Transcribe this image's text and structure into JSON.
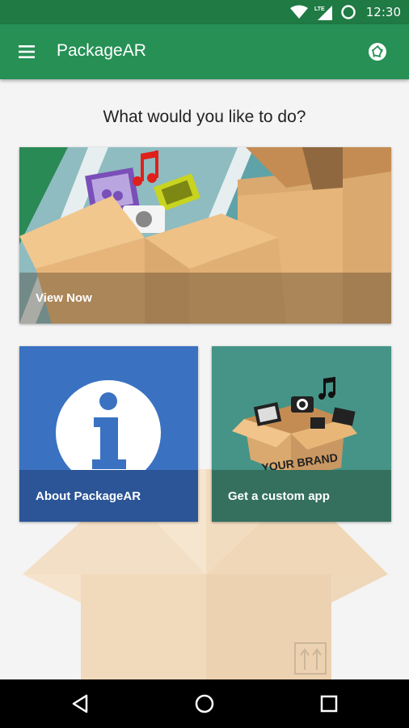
{
  "status_bar": {
    "time": "12:30",
    "network": "LTE",
    "icons": [
      "wifi-icon",
      "signal-icon",
      "circle-icon"
    ]
  },
  "app_bar": {
    "title": "PackageAR",
    "menu_icon": "hamburger-menu-icon",
    "action_icon": "camera-lens-icon"
  },
  "main": {
    "prompt": "What would you like to do?",
    "cards": [
      {
        "id": "view-now",
        "label": "View Now"
      },
      {
        "id": "about",
        "label": "About PackageAR"
      },
      {
        "id": "custom-app",
        "label": "Get a custom app",
        "image_text": "YOUR BRAND"
      }
    ]
  },
  "nav_bar": {
    "icons": [
      "back-icon",
      "home-icon",
      "recents-icon"
    ]
  },
  "colors": {
    "status_bar": "#1f7a44",
    "app_bar": "#269055",
    "about_card": "#3a72c1",
    "custom_card": "#469487"
  }
}
